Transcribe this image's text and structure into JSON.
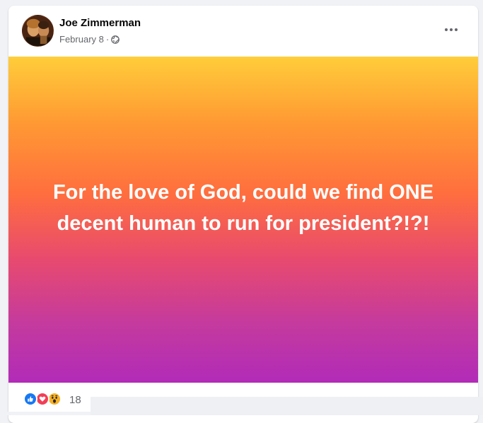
{
  "post": {
    "author": "Joe Zimmerman",
    "date": "February 8",
    "date_separator": "·",
    "audience_icon": "globe-icon",
    "menu_icon": "more-options-icon",
    "text": "For the love of God, could we find ONE decent human to run for president?!?!",
    "background_gradient": [
      "#ffcd3a",
      "#ff6e3e",
      "#b12bb8"
    ]
  },
  "reactions": {
    "icons": [
      "like-icon",
      "love-icon",
      "wow-icon"
    ],
    "count": "18",
    "colors": {
      "like": "#1877f2",
      "love": "#f33e58",
      "wow": "#f7b125"
    }
  }
}
